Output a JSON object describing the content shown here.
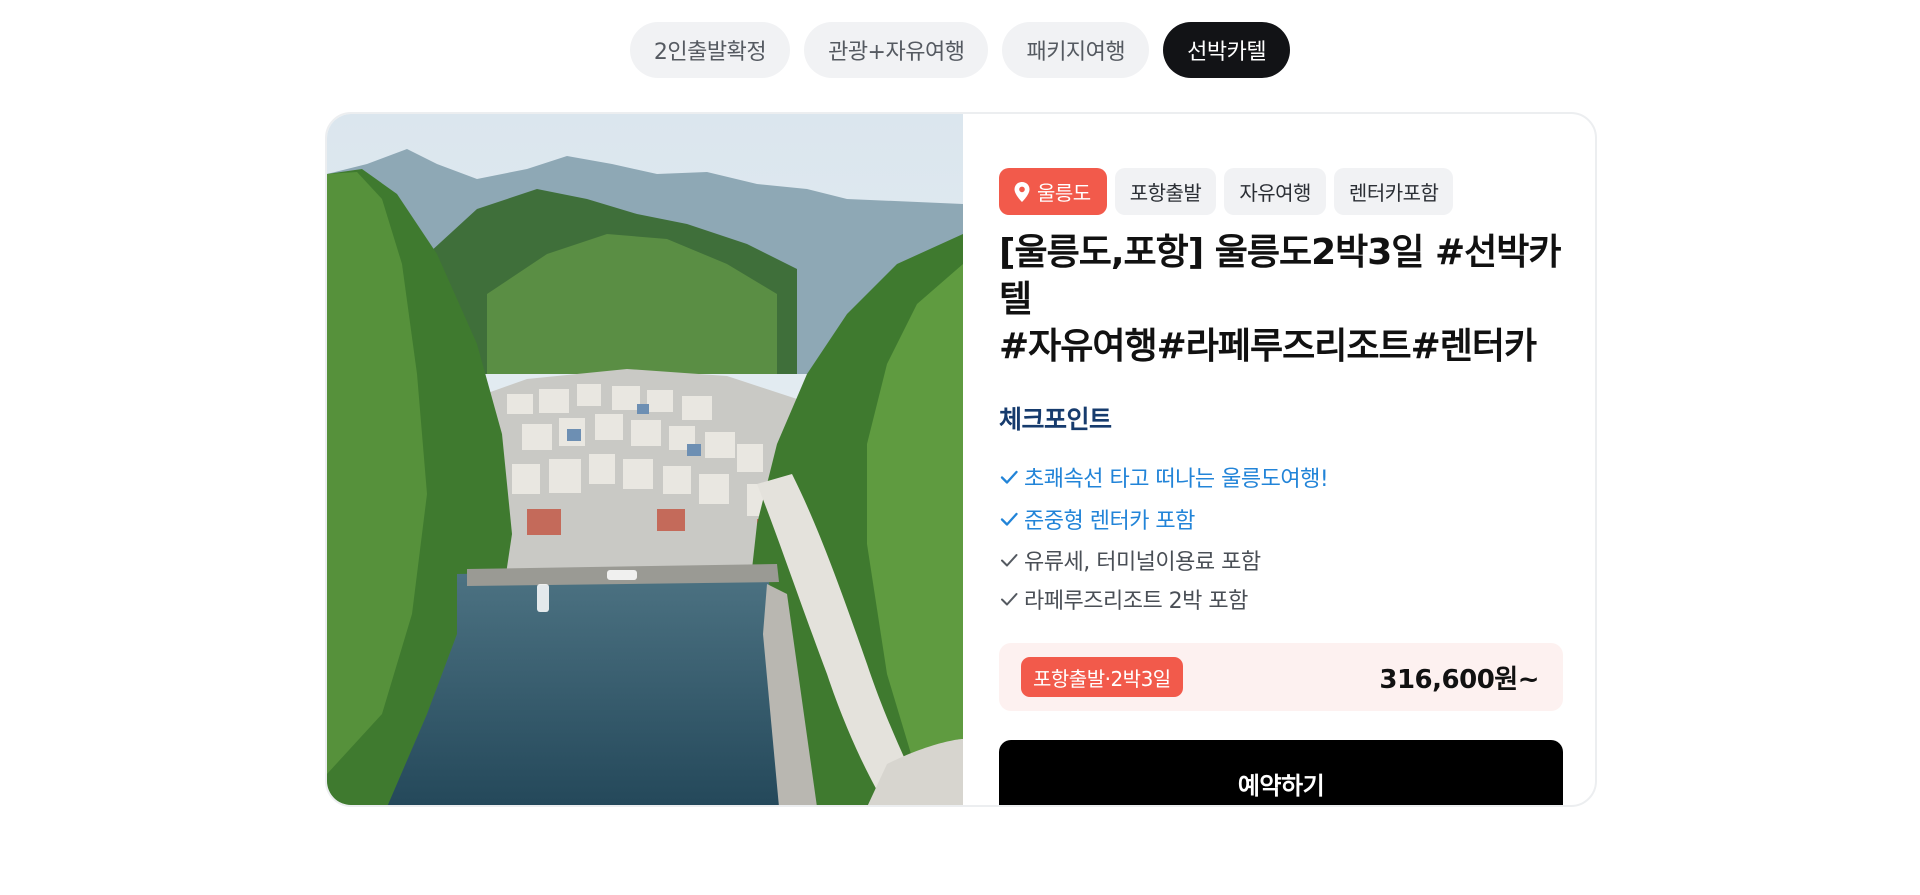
{
  "filters": [
    {
      "label": "2인출발확정",
      "active": false
    },
    {
      "label": "관광+자유여행",
      "active": false
    },
    {
      "label": "패키지여행",
      "active": false
    },
    {
      "label": "선박카텔",
      "active": true
    }
  ],
  "product": {
    "tags": [
      {
        "label": "울릉도",
        "icon": "map-pin-icon",
        "primary": true
      },
      {
        "label": "포항출발"
      },
      {
        "label": "자유여행"
      },
      {
        "label": "렌터카포함"
      }
    ],
    "title_line1": "[울릉도,포항] 울릉도2박3일 #선박카텔",
    "title_line2": "#자유여행#라페루즈리조트#렌터카",
    "checkpoint_heading": "체크포인트",
    "checkpoints": [
      {
        "text": "초쾌속선 타고 떠나는 울릉도여행!",
        "highlight": true
      },
      {
        "text": "준중형 렌터카 포함",
        "highlight": true
      },
      {
        "text": "유류세, 터미널이용료 포함",
        "highlight": false
      },
      {
        "text": "라페루즈리조트 2박 포함",
        "highlight": false
      }
    ],
    "price_badge": "포항출발·2박3일",
    "price": "316,600원~",
    "reserve_label": "예약하기"
  },
  "colors": {
    "accent_red": "#f25a4b",
    "highlight_blue": "#2284d8",
    "heading_navy": "#163b6d",
    "active_chip": "#121316"
  }
}
